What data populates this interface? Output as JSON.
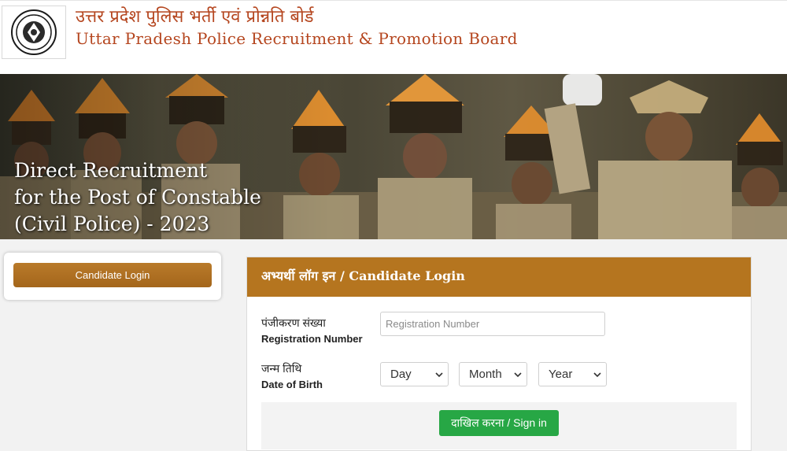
{
  "header": {
    "title_hindi": "उत्तर प्रदेश पुलिस भर्ती एवं प्रोन्नति बोर्ड",
    "title_english": "Uttar Pradesh Police Recruitment & Promotion Board",
    "logo_icon": "up-police-emblem-icon"
  },
  "banner": {
    "line1": "Direct Recruitment",
    "line2": "for the Post of Constable",
    "line3": "(Civil Police) - 2023"
  },
  "sidebar": {
    "candidate_login_label": "Candidate Login"
  },
  "login_card": {
    "title": "अभ्यर्थी लॉग इन / Candidate Login",
    "registration": {
      "label_hindi": "पंजीकरण संख्या",
      "label_english": "Registration Number",
      "placeholder": "Registration Number",
      "value": ""
    },
    "dob": {
      "label_hindi": "जन्म तिथि",
      "label_english": "Date of Birth",
      "day": "Day",
      "month": "Month",
      "year": "Year"
    },
    "submit_label": "दाखिल करना / Sign in"
  },
  "colors": {
    "brand_text": "#b5461f",
    "card_header": "#b5751f",
    "button_gold": "#a4661b",
    "submit_green": "#27a745"
  }
}
